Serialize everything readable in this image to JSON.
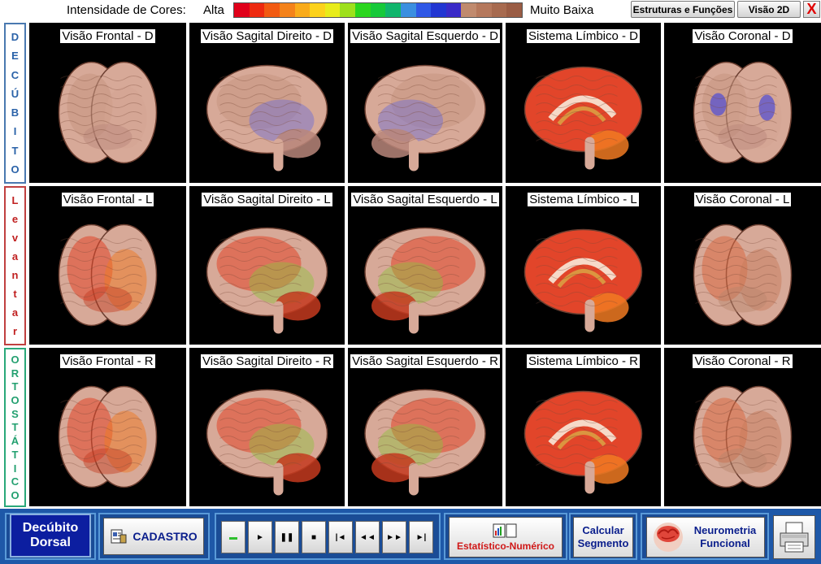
{
  "header": {
    "legend_label": "Intensidade de Cores:",
    "legend_high": "Alta",
    "legend_low": "Muito Baixa",
    "legend_colors": [
      "#e0001a",
      "#ee2a10",
      "#f25a12",
      "#f4821a",
      "#f9ab1a",
      "#fcd21b",
      "#e8ec1a",
      "#9ee01c",
      "#2bd61e",
      "#16c93a",
      "#10b56c",
      "#3b8fe0",
      "#2f58e6",
      "#2236d2",
      "#3a2ac8",
      "#c08a6e",
      "#b5785c",
      "#a76a4f",
      "#9a5c44"
    ],
    "structures_button": "Estruturas e Funções",
    "view2d_button": "Visão 2D",
    "close_button": "X"
  },
  "side_labels": [
    {
      "letters": [
        "D",
        "E",
        "C",
        "Ú",
        "B",
        "I",
        "T",
        "O"
      ],
      "color": "#2a62a8"
    },
    {
      "letters": [
        "L",
        "e",
        "v",
        "a",
        "n",
        "t",
        "a",
        "r"
      ],
      "color": "#c02020"
    },
    {
      "letters": [
        "O",
        "R",
        "T",
        "O",
        "S",
        "T",
        "Á",
        "T",
        "I",
        "C",
        "O"
      ],
      "color": "#23a070"
    }
  ],
  "rows": [
    {
      "suffix": "D",
      "cells": [
        {
          "title": "Visão Frontal - D",
          "view": "front",
          "heat": "low"
        },
        {
          "title": "Visão Sagital Direito - D",
          "view": "side-right",
          "heat": "low"
        },
        {
          "title": "Visão Sagital Esquerdo - D",
          "view": "side-left",
          "heat": "low"
        },
        {
          "title": "Sistema Límbico - D",
          "view": "limbic",
          "heat": "high"
        },
        {
          "title": "Visão Coronal - D",
          "view": "coronal",
          "heat": "low"
        }
      ]
    },
    {
      "suffix": "L",
      "cells": [
        {
          "title": "Visão Frontal - L",
          "view": "front",
          "heat": "high"
        },
        {
          "title": "Visão Sagital Direito - L",
          "view": "side-right",
          "heat": "high"
        },
        {
          "title": "Visão Sagital Esquerdo - L",
          "view": "side-left",
          "heat": "high"
        },
        {
          "title": "Sistema Límbico - L",
          "view": "limbic",
          "heat": "high"
        },
        {
          "title": "Visão Coronal - L",
          "view": "coronal",
          "heat": "mid"
        }
      ]
    },
    {
      "suffix": "R",
      "cells": [
        {
          "title": "Visão Frontal - R",
          "view": "front",
          "heat": "high"
        },
        {
          "title": "Visão Sagital Direito - R",
          "view": "side-right",
          "heat": "high"
        },
        {
          "title": "Visão Sagital Esquerdo - R",
          "view": "side-left",
          "heat": "high"
        },
        {
          "title": "Sistema Límbico - R",
          "view": "limbic",
          "heat": "high"
        },
        {
          "title": "Visão Coronal - R",
          "view": "coronal",
          "heat": "mid"
        }
      ]
    }
  ],
  "footer": {
    "position_line1": "Decúbito",
    "position_line2": "Dorsal",
    "cadastro_label": "CADASTRO",
    "cadastro_icon": "patient-form-icon",
    "media_controls": [
      {
        "name": "record",
        "glyph": "▬",
        "color": "#2ec02e"
      },
      {
        "name": "play",
        "glyph": "►",
        "color": "#000000"
      },
      {
        "name": "pause",
        "glyph": "❚❚",
        "color": "#000000"
      },
      {
        "name": "stop",
        "glyph": "■",
        "color": "#000000"
      },
      {
        "name": "skip-to-start",
        "glyph": "|◄",
        "color": "#000000"
      },
      {
        "name": "rewind",
        "glyph": "◄◄",
        "color": "#000000"
      },
      {
        "name": "fast-forward",
        "glyph": "►►",
        "color": "#000000"
      },
      {
        "name": "skip-to-end",
        "glyph": "►|",
        "color": "#000000"
      }
    ],
    "stat_icons": "chart-document-icon",
    "stat_label": "Estatístico-Numérico",
    "calc_line1": "Calcular",
    "calc_line2": "Segmento",
    "neuro_line1": "Neurometria",
    "neuro_line2": "Funcional",
    "neuro_icon": "brain-head-icon",
    "print_icon": "printer-icon"
  }
}
